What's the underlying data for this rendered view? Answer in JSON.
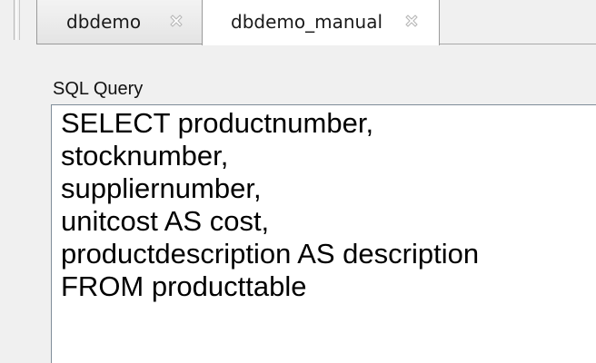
{
  "tabs": [
    {
      "label": "dbdemo",
      "active": false,
      "close_icon": "close-icon"
    },
    {
      "label": "dbdemo_manual",
      "active": true,
      "close_icon": "close-icon"
    }
  ],
  "query_panel": {
    "label": "SQL Query",
    "query_lines": [
      "SELECT productnumber,",
      "stocknumber,",
      "suppliernumber,",
      "unitcost AS cost,",
      "productdescription AS description",
      "FROM producttable"
    ]
  },
  "colors": {
    "background": "#f0f0f0",
    "editor_background": "#ffffff",
    "text": "#000000"
  }
}
